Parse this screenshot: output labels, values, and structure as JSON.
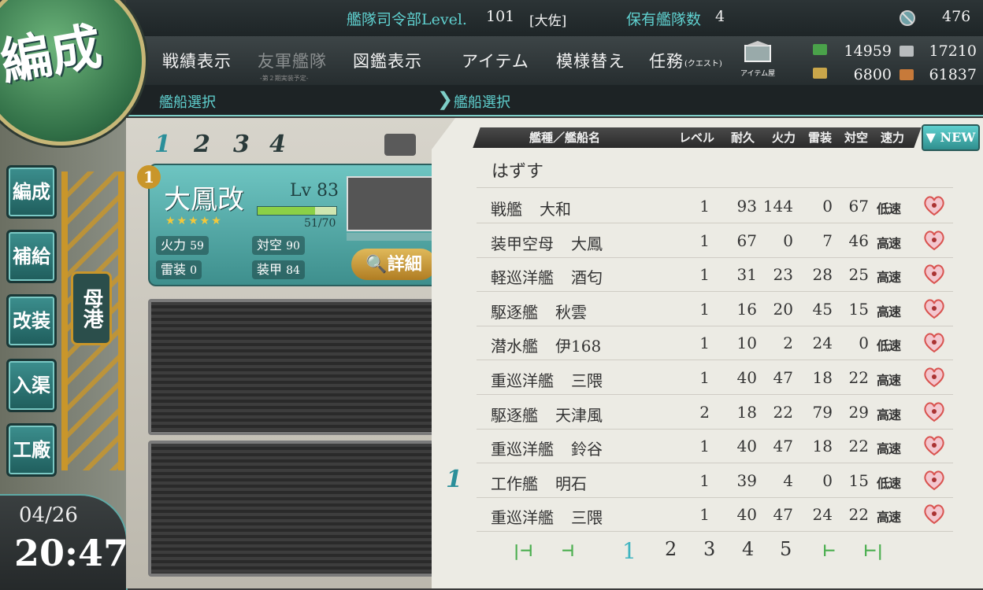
{
  "header": {
    "hq_label": "艦隊司令部Level.",
    "hq_level": "101",
    "rank": "[大佐]",
    "fleets_label": "保有艦隊数",
    "fleets_count": "4",
    "furniture_coins": "476"
  },
  "menu": {
    "items": [
      "戦績表示",
      "友軍艦隊",
      "図鑑表示",
      "アイテム",
      "模様替え",
      "任務"
    ],
    "friend_fleet_note": "-第２期実装予定-",
    "quest_note": "(クエスト)",
    "item_shop_label": "アイテム屋"
  },
  "resources": {
    "fuel": "14959",
    "steel": "17210",
    "ammo": "6800",
    "bauxite": "61837"
  },
  "subbar": {
    "left_title": "艦船選択",
    "right_title": "艦船選択"
  },
  "emblem": {
    "text": "編成"
  },
  "side": {
    "buttons": [
      "編成",
      "補給",
      "改装",
      "入渠",
      "工廠"
    ],
    "port": "母港",
    "date": "04/26",
    "time": "20:47"
  },
  "fleet": {
    "tabs": [
      "1",
      "2",
      "3",
      "4"
    ],
    "ship": {
      "slot": "1",
      "name": "大鳳改",
      "lv_label": "Lv",
      "level": "83",
      "hp": "51/70",
      "hp_fraction": 0.73,
      "stars": "★★★★★",
      "stats": [
        {
          "label": "火力",
          "value": "59"
        },
        {
          "label": "対空",
          "value": "90"
        },
        {
          "label": "雷装",
          "value": "0"
        },
        {
          "label": "装甲",
          "value": "84"
        }
      ],
      "detail_label": "詳細"
    }
  },
  "list": {
    "headers": {
      "type_name": "艦種／艦船名",
      "level": "レベル",
      "hp": "耐久",
      "fire": "火力",
      "torp": "雷装",
      "aa": "対空",
      "speed": "速力"
    },
    "sort_label": "NEW",
    "unset_label": "はずす",
    "rows": [
      {
        "type": "戦艦",
        "name": "大和",
        "level": "1",
        "hp": "93",
        "fire": "144",
        "torp": "0",
        "aa": "67",
        "speed": "低速"
      },
      {
        "type": "装甲空母",
        "name": "大鳳",
        "level": "1",
        "hp": "67",
        "fire": "0",
        "torp": "7",
        "aa": "46",
        "speed": "高速"
      },
      {
        "type": "軽巡洋艦",
        "name": "酒匂",
        "level": "1",
        "hp": "31",
        "fire": "23",
        "torp": "28",
        "aa": "25",
        "speed": "高速"
      },
      {
        "type": "駆逐艦",
        "name": "秋雲",
        "level": "1",
        "hp": "16",
        "fire": "20",
        "torp": "45",
        "aa": "15",
        "speed": "高速"
      },
      {
        "type": "潜水艦",
        "name": "伊168",
        "level": "1",
        "hp": "10",
        "fire": "2",
        "torp": "24",
        "aa": "0",
        "speed": "低速"
      },
      {
        "type": "重巡洋艦",
        "name": "三隈",
        "level": "1",
        "hp": "40",
        "fire": "47",
        "torp": "18",
        "aa": "22",
        "speed": "高速"
      },
      {
        "type": "駆逐艦",
        "name": "天津風",
        "level": "2",
        "hp": "18",
        "fire": "22",
        "torp": "79",
        "aa": "29",
        "speed": "高速"
      },
      {
        "type": "重巡洋艦",
        "name": "鈴谷",
        "level": "1",
        "hp": "40",
        "fire": "47",
        "torp": "18",
        "aa": "22",
        "speed": "高速"
      },
      {
        "type": "工作艦",
        "name": "明石",
        "level": "1",
        "hp": "39",
        "fire": "4",
        "torp": "0",
        "aa": "15",
        "speed": "低速"
      },
      {
        "type": "重巡洋艦",
        "name": "三隈",
        "level": "1",
        "hp": "40",
        "fire": "47",
        "torp": "24",
        "aa": "22",
        "speed": "高速"
      }
    ],
    "fleet_mark": "1",
    "pages": [
      "1",
      "2",
      "3",
      "4",
      "5"
    ],
    "current_page": "1"
  },
  "colors": {
    "accent": "#5fd0cf",
    "page_active": "#3fb4c0",
    "heart": "#d9534f"
  }
}
